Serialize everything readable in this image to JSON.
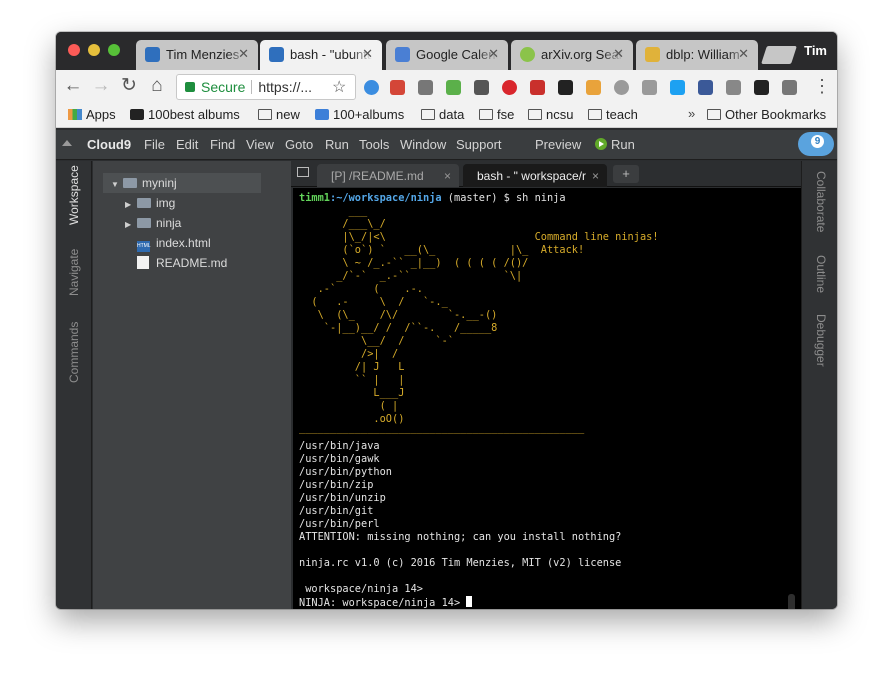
{
  "browser": {
    "tabs": [
      {
        "label": "Tim Menzies",
        "favicon": "cloud9-icon",
        "color": "#2f6fbd",
        "active": false
      },
      {
        "label": "bash - \"ubuntu",
        "favicon": "cloud9-icon",
        "color": "#2f6fbd",
        "active": true
      },
      {
        "label": "Google Calendar",
        "favicon": "calendar-icon",
        "color": "#4a7fd4",
        "active": false
      },
      {
        "label": "arXiv.org Search",
        "favicon": "smiley-icon",
        "color": "#8bc34a",
        "active": false
      },
      {
        "label": "dblp: William",
        "favicon": "dblp-icon",
        "color": "#e0b23a",
        "active": false
      }
    ],
    "profile": "Tim",
    "omnibox": {
      "secure_label": "Secure",
      "url": "https://..."
    },
    "bookmarks": [
      {
        "label": "Apps",
        "icon": "apps-grid-icon"
      },
      {
        "label": "100best albums",
        "icon": "wikipedia-icon"
      },
      {
        "label": "new",
        "icon": "folder-icon"
      },
      {
        "label": "100+albums",
        "icon": "checkbox-icon"
      },
      {
        "label": "data",
        "icon": "folder-icon"
      },
      {
        "label": "fse",
        "icon": "folder-icon"
      },
      {
        "label": "ncsu",
        "icon": "folder-icon"
      },
      {
        "label": "teach",
        "icon": "folder-icon"
      },
      {
        "label": "Other Bookmarks",
        "icon": "folder-icon"
      }
    ],
    "overflow_chevron": "»"
  },
  "ide": {
    "brand": "Cloud9",
    "menu": [
      "File",
      "Edit",
      "Find",
      "View",
      "Goto",
      "Run",
      "Tools",
      "Window",
      "Support"
    ],
    "preview": "Preview",
    "run": "Run",
    "left_tabs": [
      "Workspace",
      "Navigate",
      "Commands"
    ],
    "right_tabs": [
      "Collaborate",
      "Outline",
      "Debugger"
    ],
    "tree": [
      {
        "name": "myninj",
        "type": "root"
      },
      {
        "name": "img",
        "type": "folder"
      },
      {
        "name": "ninja",
        "type": "folder"
      },
      {
        "name": "index.html",
        "type": "html"
      },
      {
        "name": "README.md",
        "type": "file"
      }
    ],
    "editor_tabs": [
      {
        "label": "[P] /README.md",
        "close": "×"
      },
      {
        "label": "bash - \" workspace/r",
        "close": "×"
      }
    ],
    "add_tab": "+"
  },
  "terminal": {
    "prompt_user": "timm1",
    "prompt_path": ":~/workspace/ninja",
    "prompt_rest": " (master) $ sh ninja",
    "ascii_art": [
      "        ___",
      "       /___\\_/",
      "       |\\_/|<\\                        Command line ninjas!",
      "       (`o`) `   __(\\_            |\\_  Attack!",
      "       \\ ~ /_.-`` _|__)  ( ( ( ( /()/",
      "      _/`-`  _.-``               `\\|",
      "   .-`      (    .-.",
      "  (   .-     \\  /   `-._",
      "   \\  (\\_    /\\/        `-.__-()",
      "    `-|__)__/ /  /``-.   /_____8",
      "          \\__/  /     `-`",
      "          />|  /",
      "         /| J   L",
      "         `` |   |",
      "            L___J",
      "             ( |",
      "            .oO()"
    ],
    "rule": "______________________________________________",
    "output": [
      "/usr/bin/java",
      "/usr/bin/gawk",
      "/usr/bin/python",
      "/usr/bin/zip",
      "/usr/bin/unzip",
      "/usr/bin/git",
      "/usr/bin/perl",
      "ATTENTION: missing nothing; can you install nothing?",
      "",
      "ninja.rc v1.0 (c) 2016 Tim Menzies, MIT (v2) license",
      "",
      " workspace/ninja 14>",
      "NINJA: workspace/ninja 14> "
    ]
  },
  "colors": {
    "ascii": "#d6ab2a",
    "prompt_user": "#62d35a",
    "prompt_path": "#54a7e8",
    "run_green": "#61a92a"
  }
}
